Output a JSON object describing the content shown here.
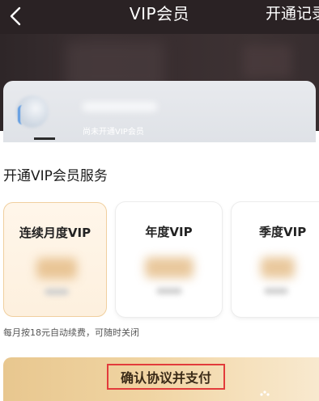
{
  "navbar": {
    "back_icon": "chevron-left-icon",
    "title": "VIP会员",
    "record_link": "开通记录"
  },
  "user_card": {
    "status": "尚未开通VIP会员"
  },
  "section": {
    "title": "开通VIP会员服务"
  },
  "plans": [
    {
      "name": "连续月度VIP",
      "selected": true
    },
    {
      "name": "年度VIP",
      "selected": false
    },
    {
      "name": "季度VIP",
      "selected": false
    }
  ],
  "renew_note": "每月按18元自动续费，可随时关闭",
  "pay_button": {
    "label": "确认协议并支付"
  },
  "colors": {
    "navbar_bg": "#2a2224",
    "selected_plan_border": "#f0cf9f",
    "pay_bar_gold": "#e8c78f",
    "highlight_red": "#e23b3b"
  }
}
